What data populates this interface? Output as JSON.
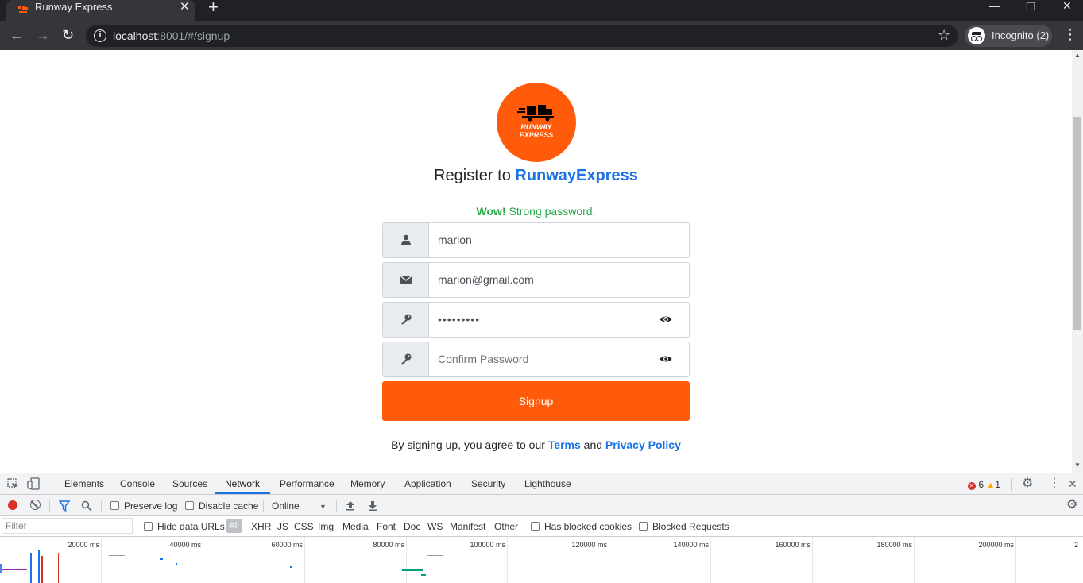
{
  "browser": {
    "tab_title": "Runway Express",
    "tab_close": "✕",
    "new_tab": "+",
    "url_host": "localhost",
    "url_rest": ":8001/#/signup",
    "incognito_label": "Incognito (2)",
    "win_min": "—",
    "win_restore": "❐",
    "win_close": "✕",
    "back": "←",
    "forward": "→",
    "reload": "↻",
    "star": "☆",
    "kebab": "⋮",
    "info": "i"
  },
  "signup": {
    "logo_line1": "RUNWAY",
    "logo_line2": "EXPRESS",
    "heading_prefix": "Register to ",
    "heading_brand": "RunwayExpress",
    "status_strong": "Wow!",
    "status_text": " Strong password.",
    "username_value": "marion",
    "email_value": "marion@gmail.com",
    "password_value": "•••••••••",
    "confirm_placeholder": "Confirm Password",
    "signup_label": "Signup",
    "terms_prefix": "By signing up, you agree to our ",
    "terms_link": "Terms",
    "terms_and": " and ",
    "privacy_link": "Privacy Policy",
    "brand_color": "#ff5b0a",
    "link_color": "#1a73e8",
    "success_color": "#28a745"
  },
  "devtools": {
    "tabs": [
      "Elements",
      "Console",
      "Sources",
      "Network",
      "Performance",
      "Memory",
      "Application",
      "Security",
      "Lighthouse"
    ],
    "active_tab": "Network",
    "errors": "6",
    "warnings": "1",
    "preserve_log": "Preserve log",
    "disable_cache": "Disable cache",
    "throttle": "Online",
    "filter_placeholder": "Filter",
    "hide_data_urls": "Hide data URLs",
    "all": "All",
    "types": [
      "XHR",
      "JS",
      "CSS",
      "Img",
      "Media",
      "Font",
      "Doc",
      "WS",
      "Manifest",
      "Other"
    ],
    "has_blocked_cookies": "Has blocked cookies",
    "blocked_requests": "Blocked Requests",
    "timeline_ticks": [
      "20000 ms",
      "40000 ms",
      "60000 ms",
      "80000 ms",
      "100000 ms",
      "120000 ms",
      "140000 ms",
      "160000 ms",
      "180000 ms",
      "200000 ms",
      "2"
    ]
  }
}
